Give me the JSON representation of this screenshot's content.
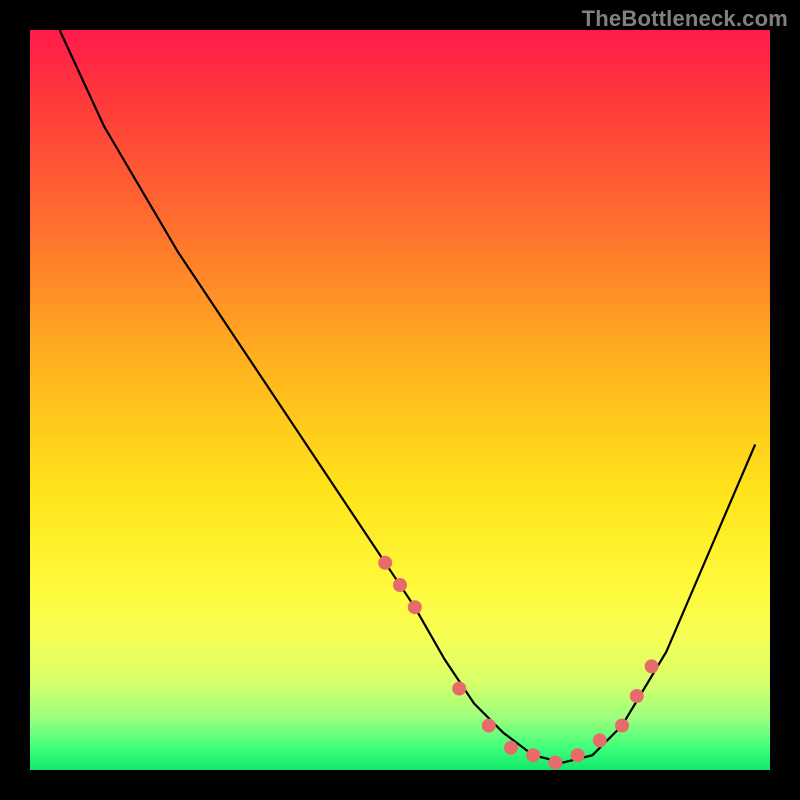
{
  "attribution": "TheBottleneck.com",
  "chart_data": {
    "type": "line",
    "title": "",
    "xlabel": "",
    "ylabel": "",
    "xlim": [
      0,
      100
    ],
    "ylim": [
      0,
      100
    ],
    "grid": false,
    "legend": false,
    "series": [
      {
        "name": "curve",
        "color": "#000000",
        "x": [
          4,
          10,
          20,
          30,
          40,
          48,
          52,
          56,
          60,
          64,
          68,
          72,
          76,
          80,
          86,
          92,
          98
        ],
        "values": [
          100,
          87,
          70,
          55,
          40,
          28,
          22,
          15,
          9,
          5,
          2,
          1,
          2,
          6,
          16,
          30,
          44
        ]
      }
    ],
    "markers": {
      "name": "dots",
      "color": "#e76b6b",
      "radius": 7,
      "x": [
        48,
        50,
        52,
        58,
        62,
        65,
        68,
        71,
        74,
        77,
        80,
        82,
        84
      ],
      "values": [
        28,
        25,
        22,
        11,
        6,
        3,
        2,
        1,
        2,
        4,
        6,
        10,
        14
      ]
    }
  }
}
